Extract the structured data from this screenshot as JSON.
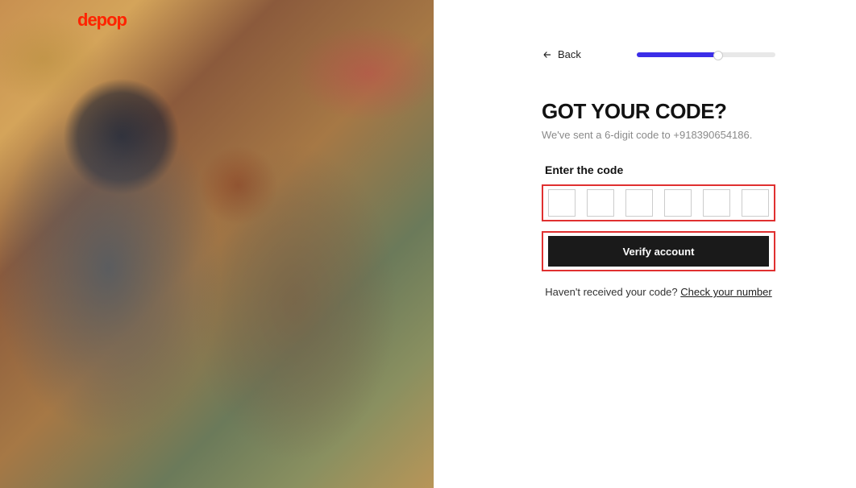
{
  "logo": "depop",
  "back_label": "Back",
  "progress_percent": 60,
  "heading": "GOT YOUR CODE?",
  "subtext": "We've sent a 6-digit code to +918390654186.",
  "code_label": "Enter the code",
  "code_digits": [
    "",
    "",
    "",
    "",
    "",
    ""
  ],
  "verify_label": "Verify account",
  "resend_prompt": "Haven't received your code? ",
  "resend_link": "Check your number"
}
